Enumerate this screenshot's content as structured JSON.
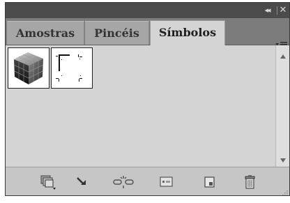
{
  "panel": {
    "controls": {
      "collapse_label": "◂◂",
      "close_label": "✕"
    },
    "tabs": [
      {
        "label": "Amostras",
        "active": false
      },
      {
        "label": "Pincéis",
        "active": false
      },
      {
        "label": "Símbolos",
        "active": true
      }
    ],
    "menu_icon": "panel-menu-icon"
  },
  "symbols": [
    {
      "icon": "cube-icon"
    },
    {
      "icon": "crop-marks-icon"
    }
  ],
  "toolbar": {
    "icons": [
      "symbol-libraries-menu-icon",
      "place-symbol-instance-icon",
      "break-link-icon",
      "symbol-options-icon",
      "new-symbol-icon",
      "delete-symbol-icon"
    ]
  },
  "colors": {
    "title_bar": "#4b4b4b",
    "tab_bar": "#7c7c7c",
    "panel_bg": "#d4d4d4",
    "bottom_bar": "#c6c6c6"
  }
}
